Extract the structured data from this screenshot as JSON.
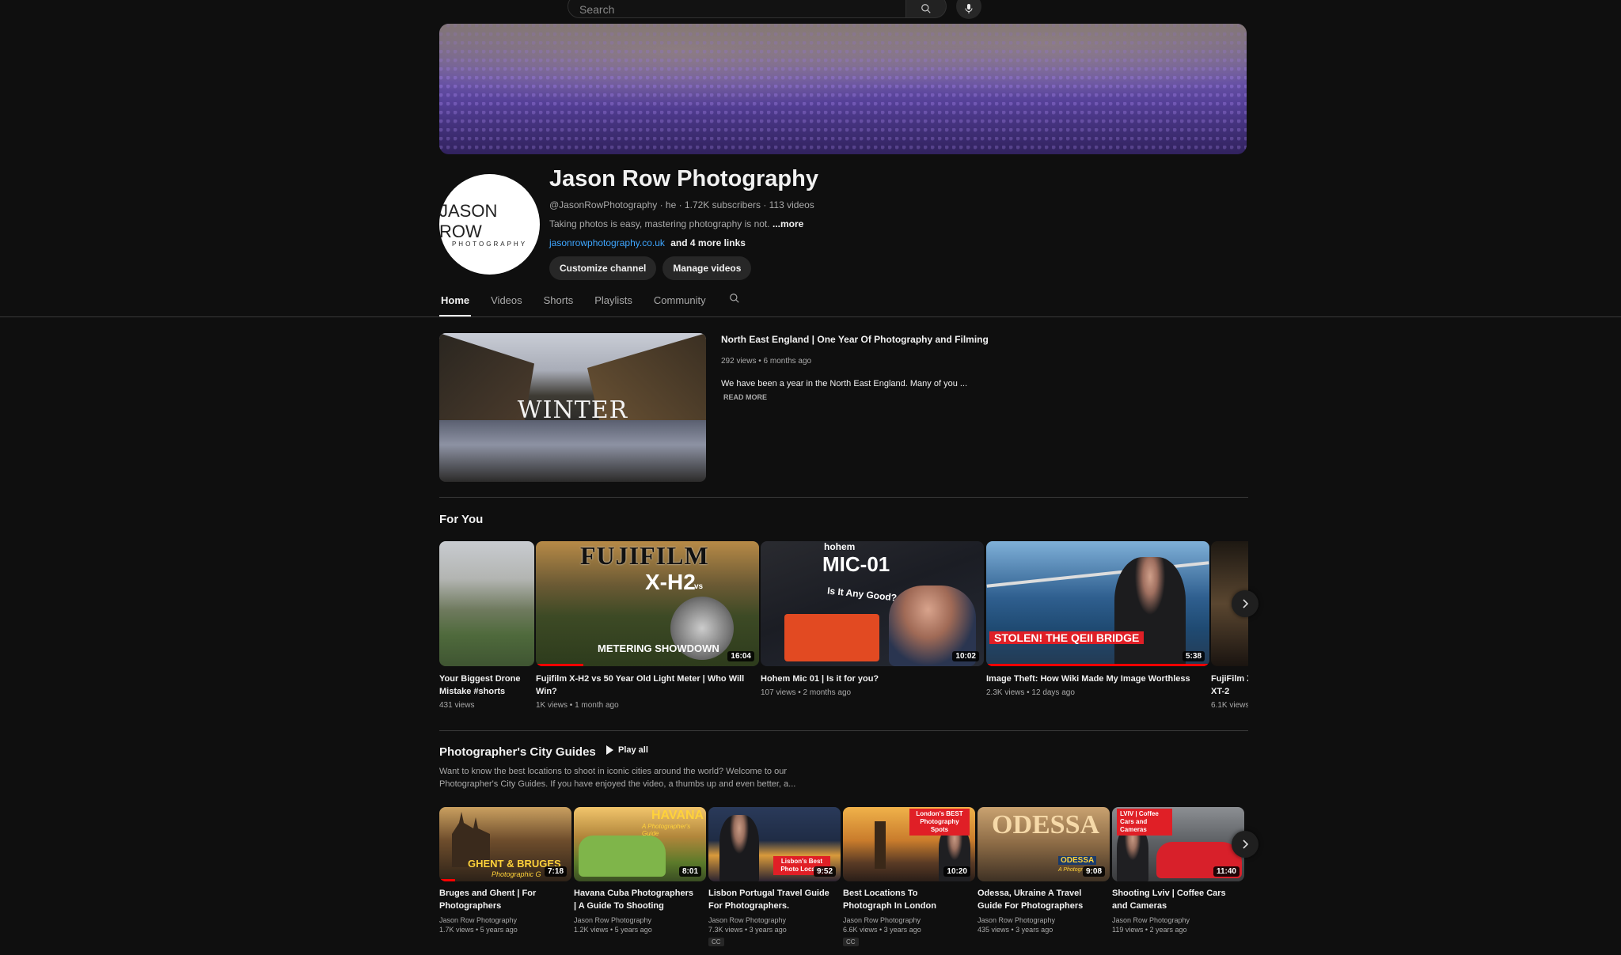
{
  "search": {
    "placeholder": "Search"
  },
  "channel": {
    "name": "Jason Row Photography",
    "avatar_line1": "JASON ROW",
    "avatar_line2": "PHOTOGRAPHY",
    "meta": "@JasonRowPhotography · he · 1.72K subscribers · 113 videos",
    "description": "Taking photos is easy, mastering photography is not.",
    "description_more": "...more",
    "link": "jasonrowphotography.co.uk",
    "more_links": "and 4 more links",
    "buttons": {
      "customize": "Customize channel",
      "manage": "Manage videos"
    }
  },
  "tabs": [
    {
      "label": "Home",
      "active": true
    },
    {
      "label": "Videos"
    },
    {
      "label": "Shorts"
    },
    {
      "label": "Playlists"
    },
    {
      "label": "Community"
    }
  ],
  "featured": {
    "thumb_text": "WINTER",
    "title": "North East England | One Year Of Photography and Filming",
    "meta": "292 views • 6 months ago",
    "description": "We have been a year in the North East England. Many of you ...",
    "read_more": "READ MORE"
  },
  "for_you": {
    "title": "For You",
    "items": [
      {
        "title_l1": "Your Biggest Drone",
        "title_l2": "Mistake #shorts",
        "meta": "431 views"
      },
      {
        "title_l1": "Fujifilm X-H2 vs 50 Year Old Light Meter | Who Will",
        "title_l2": "Win?",
        "meta": "1K views • 1 month ago",
        "duration": "16:04",
        "overlay_top": "FUJIFILM",
        "overlay_mid": "X-H2",
        "overlay_vs": "vs",
        "overlay_bottom": "METERING SHOWDOWN"
      },
      {
        "title_l1": "Hohem Mic 01 | Is it for you?",
        "meta": "107 views • 2 months ago",
        "duration": "10:02",
        "overlay_brand": "hohem",
        "overlay_title": "MIC-01",
        "overlay_q": "Is It Any Good?"
      },
      {
        "title_l1": "Image Theft: How Wiki Made My Image Worthless",
        "meta": "2.3K views • 12 days ago",
        "duration": "5:38",
        "overlay_banner": "STOLEN! THE QEII BRIDGE"
      },
      {
        "title_l1": "FujiFilm X",
        "title_l2": "XT-2",
        "meta": "6.1K views"
      }
    ]
  },
  "playlist": {
    "title": "Photographer's City Guides",
    "play_all": "Play all",
    "desc_l1": "Want to know the best locations to shoot in iconic cities around the world? Welcome to our",
    "desc_l2": "Photographer's City Guides. If you have enjoyed the video, a thumbs up and even better, a...",
    "items": [
      {
        "title_l1": "Bruges and Ghent | For",
        "title_l2": "Photographers",
        "channel": "Jason Row Photography",
        "meta": "1.7K views • 5 years ago",
        "duration": "7:18",
        "overlay": "GHENT & BRUGES",
        "overlay_sub": "Photographic G"
      },
      {
        "title_l1": "Havana Cuba Photographers",
        "title_l2": "| A Guide To Shooting",
        "channel": "Jason Row Photography",
        "meta": "1.2K views • 5 years ago",
        "duration": "8:01",
        "overlay": "HAVANA",
        "overlay_sub": "A Photographer's Guide"
      },
      {
        "title_l1": "Lisbon Portugal Travel Guide",
        "title_l2": "For Photographers.",
        "channel": "Jason Row Photography",
        "meta": "7.3K views • 3 years ago",
        "duration": "9:52",
        "overlay": "Lisbon's Best Photo Locatio",
        "cc": "CC"
      },
      {
        "title_l1": "Best Locations To",
        "title_l2": "Photograph In London",
        "channel": "Jason Row Photography",
        "meta": "6.6K views • 3 years ago",
        "duration": "10:20",
        "overlay": "London's BEST Photography Spots",
        "cc": "CC"
      },
      {
        "title_l1": "Odessa, Ukraine A Travel",
        "title_l2": "Guide For Photographers",
        "channel": "Jason Row Photography",
        "meta": "435 views • 3 years ago",
        "duration": "9:08",
        "overlay": "ODESSA",
        "overlay_sub": "A Photographer's"
      },
      {
        "title_l1": "Shooting Lviv | Coffee Cars",
        "title_l2": "and Cameras",
        "channel": "Jason Row Photography",
        "meta": "119 views • 2 years ago",
        "duration": "11:40",
        "overlay": "LVIV | Coffee Cars and Cameras"
      }
    ]
  },
  "colors": {
    "background": "#0f0f0f",
    "link": "#3ea6ff",
    "accent_red": "#ff0000"
  },
  "icons": {
    "search": "search-icon",
    "mic": "mic-icon",
    "next": "chevron-right-icon",
    "play": "play-icon"
  }
}
